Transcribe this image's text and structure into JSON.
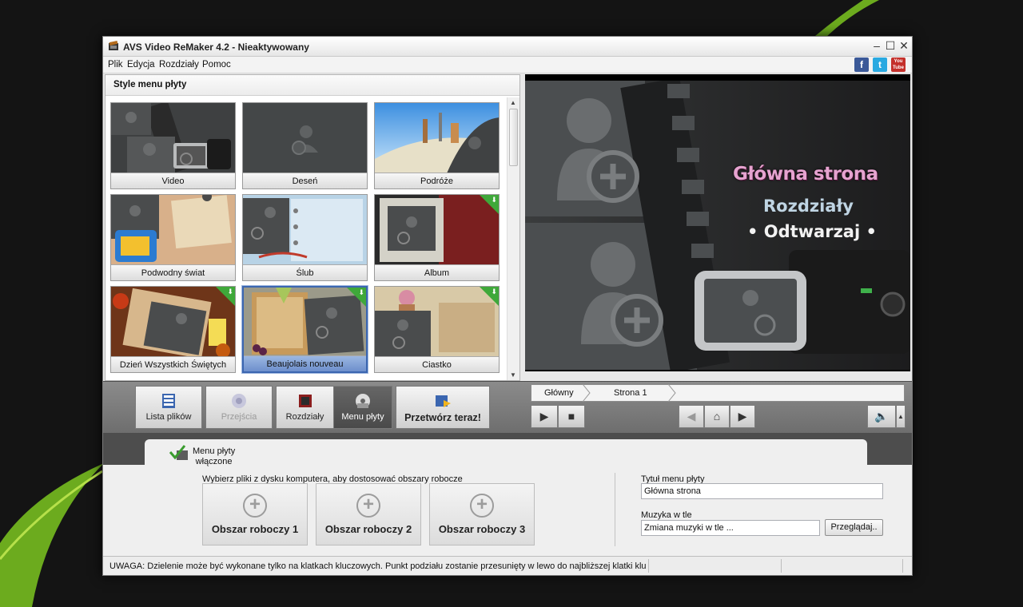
{
  "window": {
    "title": "AVS Video ReMaker 4.2 - Nieaktywowany",
    "controls": [
      "–",
      "☐",
      "✕"
    ]
  },
  "menu": {
    "items": [
      "Plik",
      "Edycja",
      "Rozdziały",
      "Pomoc"
    ],
    "social": [
      "f",
      "t",
      "You Tube"
    ]
  },
  "styles_panel": {
    "header": "Style menu płyty",
    "tiles": [
      {
        "label": "Video",
        "selected": false,
        "download": false
      },
      {
        "label": "Deseń",
        "selected": false,
        "download": false
      },
      {
        "label": "Podróże",
        "selected": false,
        "download": false
      },
      {
        "label": "Podwodny świat",
        "selected": false,
        "download": false
      },
      {
        "label": "Ślub",
        "selected": false,
        "download": false
      },
      {
        "label": "Album",
        "selected": false,
        "download": true
      },
      {
        "label": "Dzień Wszystkich Świętych",
        "selected": false,
        "download": true
      },
      {
        "label": "Beaujolais nouveau",
        "selected": true,
        "download": true
      },
      {
        "label": "Ciastko",
        "selected": false,
        "download": true
      }
    ]
  },
  "preview": {
    "title": "Główna strona",
    "chapters": "Rozdziały",
    "play": "• Odtwarzaj •"
  },
  "toolbar": {
    "files": "Lista plików",
    "transitions": "Przejścia",
    "chapters": "Rozdziały",
    "disc_menu": "Menu płyty",
    "convert": "Przetwórz teraz!"
  },
  "navigation": {
    "crumbs": [
      "Główny",
      "Strona 1"
    ]
  },
  "disc_menu_tab": {
    "line1": "Menu płyty",
    "line2": "włączone"
  },
  "workspaces": {
    "note": "Wybierz pliki z dysku komputera, aby dostosować obszary robocze",
    "areas": [
      "Obszar roboczy 1",
      "Obszar roboczy 2",
      "Obszar roboczy 3"
    ]
  },
  "settings": {
    "title_label": "Tytuł menu płyty",
    "title_value": "Główna strona",
    "music_label": "Muzyka w tle",
    "music_value": "Zmiana muzyki w tle ...",
    "browse": "Przeglądaj.."
  },
  "status": {
    "text": "UWAGA: Dzielenie może być wykonane tylko na klatkach kluczowych. Punkt podziału zostanie przesunięty w lewo do najbliższej klatki kluczowej."
  }
}
